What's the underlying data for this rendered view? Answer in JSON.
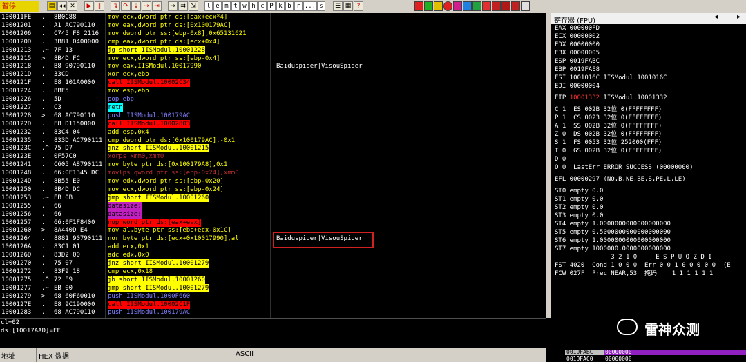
{
  "toolbar": {
    "status": "暂停",
    "nav_buttons": [
      "◂",
      "▶",
      "‖",
      "▸"
    ],
    "letters": [
      "l",
      "e",
      "m",
      "t",
      "w",
      "h",
      "c",
      "P",
      "k",
      "b",
      "r",
      "...",
      "s"
    ]
  },
  "disasm": {
    "rows": [
      {
        "addr": "100011FE",
        "mark": ".",
        "hex": "8B0C88",
        "asm": "mov ecx,dword ptr ds:[eax+ecx*4]",
        "cmt": ""
      },
      {
        "addr": "10001201",
        "mark": ".",
        "hex": "A1 AC790110",
        "asm": "mov eax,dword ptr ds:[0x100179AC]",
        "cmt": ""
      },
      {
        "addr": "10001206",
        "mark": ".",
        "hex": "C745 F8 2116",
        "asm": "mov dword ptr ss:[ebp-0x8],0x65131621",
        "cmt": ""
      },
      {
        "addr": "1000120D",
        "mark": ".",
        "hex": "3B81 0400000",
        "asm": "cmp eax,dword ptr ds:[ecx+0x4]",
        "cmt": ""
      },
      {
        "addr": "10001213",
        "mark": ".~",
        "hex": "7F 13",
        "asm": "jg short IISModul.10001228",
        "cmt": ""
      },
      {
        "addr": "10001215",
        "mark": ">",
        "hex": "8B4D FC",
        "asm": "mov ecx,dword ptr ss:[ebp-0x4]",
        "cmt": ""
      },
      {
        "addr": "10001218",
        "mark": ".",
        "hex": "B8 90790110",
        "asm": "mov eax,IISModul.10017990",
        "cmt": "Baiduspider|VisouSpider"
      },
      {
        "addr": "1000121D",
        "mark": ".",
        "hex": "33CD",
        "asm": "xor ecx,ebp",
        "cmt": ""
      },
      {
        "addr": "1000121F",
        "mark": ".",
        "hex": "E8 101A0000",
        "asm": "call IISModul.10002C34",
        "cmt": ""
      },
      {
        "addr": "10001224",
        "mark": ".",
        "hex": "8BE5",
        "asm": "mov esp,ebp",
        "cmt": ""
      },
      {
        "addr": "10001226",
        "mark": ".",
        "hex": "5D",
        "asm": "pop ebp",
        "cmt": ""
      },
      {
        "addr": "10001227",
        "mark": ".",
        "hex": "C3",
        "asm": "retn",
        "cmt": ""
      },
      {
        "addr": "10001228",
        "mark": ">",
        "hex": "68 AC790110",
        "asm": "push IISModul.100179AC",
        "cmt": ""
      },
      {
        "addr": "1000122D",
        "mark": ".",
        "hex": "E8 D1150000",
        "asm": "call IISModul.10002803",
        "cmt": ""
      },
      {
        "addr": "10001232",
        "mark": ".",
        "hex": "83C4 04",
        "asm": "add esp,0x4",
        "cmt": ""
      },
      {
        "addr": "10001235",
        "mark": ".",
        "hex": "833D AC790111",
        "asm": "cmp dword ptr ds:[0x100179AC],-0x1",
        "cmt": ""
      },
      {
        "addr": "1000123C",
        "mark": ".^",
        "hex": "75 D7",
        "asm": "jnz short IISModul.10001215",
        "cmt": ""
      },
      {
        "addr": "1000123E",
        "mark": ".",
        "hex": "0F57C0",
        "asm": "xorps xmm0,xmm0",
        "cmt": ""
      },
      {
        "addr": "10001241",
        "mark": ".",
        "hex": "C605 A8790111",
        "asm": "mov byte ptr ds:[0x100179A8],0x1",
        "cmt": ""
      },
      {
        "addr": "10001248",
        "mark": ".",
        "hex": "66:0F1345 DC",
        "asm": "movlps qword ptr ss:[ebp-0x24],xmm0",
        "cmt": ""
      },
      {
        "addr": "1000124D",
        "mark": ".",
        "hex": "8B55 E0",
        "asm": "mov edx,dword ptr ss:[ebp-0x20]",
        "cmt": ""
      },
      {
        "addr": "10001250",
        "mark": ".",
        "hex": "8B4D DC",
        "asm": "mov ecx,dword ptr ss:[ebp-0x24]",
        "cmt": ""
      },
      {
        "addr": "10001253",
        "mark": ".~",
        "hex": "EB 0B",
        "asm": "jmp short IISModul.10001260",
        "cmt": ""
      },
      {
        "addr": "10001255",
        "mark": ".",
        "hex": "66",
        "asm": "datasize:",
        "cmt": ""
      },
      {
        "addr": "10001256",
        "mark": ".",
        "hex": "66",
        "asm": "datasize:",
        "cmt": ""
      },
      {
        "addr": "10001257",
        "mark": ".",
        "hex": "66:0F1F8400",
        "asm": "nop word ptr ds:[eax+eax]",
        "cmt": ""
      },
      {
        "addr": "10001260",
        "mark": ">",
        "hex": "8A440D E4",
        "asm": "mov al,byte ptr ss:[ebp+ecx-0x1C]",
        "cmt": ""
      },
      {
        "addr": "10001264",
        "mark": ".",
        "hex": "8881 90790111",
        "asm": "nor byte ptr ds:[ecx+0x10017990],al",
        "cmt": "Baiduspider|VisouSpider"
      },
      {
        "addr": "1000126A",
        "mark": ".",
        "hex": "83C1 01",
        "asm": "add ecx,0x1",
        "cmt": ""
      },
      {
        "addr": "1000126D",
        "mark": ".",
        "hex": "83D2 00",
        "asm": "adc edx,0x0",
        "cmt": ""
      },
      {
        "addr": "10001270",
        "mark": ".",
        "hex": "75 07",
        "asm": "jnz short IISModul.10001279",
        "cmt": ""
      },
      {
        "addr": "10001272",
        "mark": ".",
        "hex": "83F9 18",
        "asm": "cmp ecx,0x18",
        "cmt": ""
      },
      {
        "addr": "10001275",
        "mark": ".^",
        "hex": "72 E9",
        "asm": "jb short IISModul.10001260",
        "cmt": ""
      },
      {
        "addr": "10001277",
        "mark": ".~",
        "hex": "EB 00",
        "asm": "jmp short IISModul.10001279",
        "cmt": ""
      },
      {
        "addr": "10001279",
        "mark": ">",
        "hex": "68 60F60010",
        "asm": "push IISModul.1000F660",
        "cmt": ""
      },
      {
        "addr": "1000127E",
        "mark": ".",
        "hex": "E8 9C190000",
        "asm": "call IISModul.10002C1F",
        "cmt": ""
      },
      {
        "addr": "10001283",
        "mark": ".",
        "hex": "68 AC790110",
        "asm": "push IISModul.100179AC",
        "cmt": ""
      }
    ]
  },
  "info": {
    "line1": "cl=02",
    "line2": "ds:[10017AAD]=FF"
  },
  "dump": {
    "col_addr": "地址",
    "col_hex": "HEX 数据",
    "col_ascii": "ASCII"
  },
  "registers": {
    "title": "寄存器 (FPU)",
    "gp": [
      "EAX 000000FD",
      "ECX 00000002",
      "EDX 00000000",
      "EBX 00000005",
      "ESP 0019FABC",
      "EBP 0019FAE8",
      "ESI 1001016C IISModul.1001016C",
      "EDI 00000004"
    ],
    "eip_label": "EIP",
    "eip_value": "10001332",
    "eip_sym": "IISModul.10001332",
    "flags": [
      "C 1  ES 002B 32位 0(FFFFFFFF)",
      "P 1  CS 0023 32位 0(FFFFFFFF)",
      "A 1  SS 002B 32位 0(FFFFFFFF)",
      "Z 0  DS 002B 32位 0(FFFFFFFF)",
      "S 1  FS 0053 32位 252000(FFF)",
      "T 0  GS 002B 32位 0(FFFFFFFF)",
      "D 0",
      "O 0  LastErr ERROR_SUCCESS (00000000)"
    ],
    "efl": "EFL 00000297 (NO,B,NE,BE,S,PE,L,LE)",
    "fpu": [
      "ST0 empty 0.0",
      "ST1 empty 0.0",
      "ST2 empty 0.0",
      "ST3 empty 0.0",
      "ST4 empty 1.0000000000000000000",
      "ST5 empty 0.5000000000000000000",
      "ST6 empty 1.0000000000000000000",
      "ST7 empty 1000000.0000000000000"
    ],
    "fpu_hdr": "               3 2 1 0     E S P U O Z D I",
    "fst": "FST 4020  Cond 1 0 0 0  Err 0 0 1 0 0 0 0 0  (E",
    "fcw": "FCW 027F  Prec NEAR,53  掩码    1 1 1 1 1 1"
  },
  "stack": {
    "addr": "0019FABC",
    "val": "00000000",
    "addr2": "0019FAC0",
    "val2": "00000000"
  },
  "watermark": "雷神众测"
}
